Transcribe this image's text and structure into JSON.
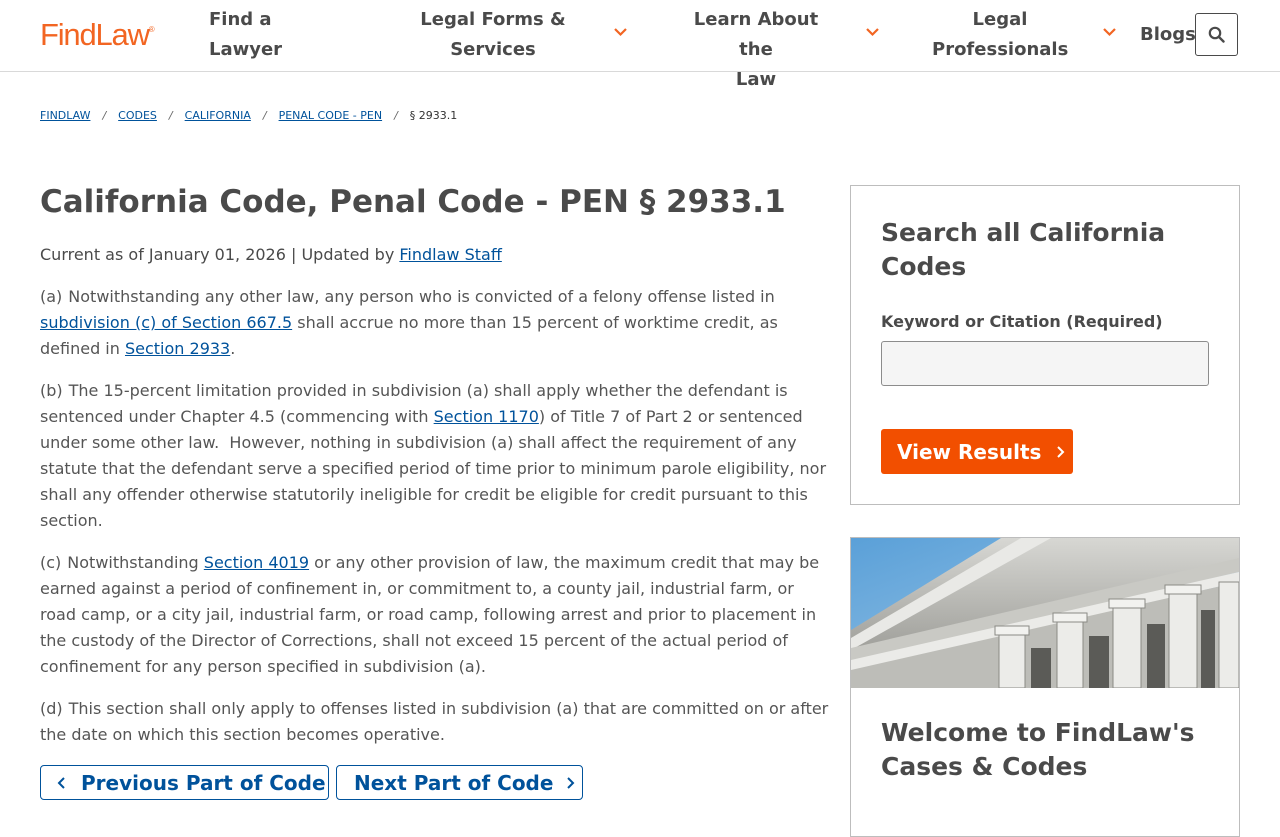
{
  "header": {
    "logo": "FindLaw",
    "logo_mark": "®",
    "nav": [
      {
        "line1": "Find a",
        "line2": "Lawyer"
      },
      {
        "line1": "Legal Forms &",
        "line2": "Services"
      },
      {
        "line1": "Learn About the",
        "line2": "Law"
      },
      {
        "line1": "Legal",
        "line2": "Professionals"
      },
      {
        "line1": "Blogs"
      }
    ],
    "search_icon": "search-icon",
    "accent": "#f26522"
  },
  "breadcrumb": {
    "items": [
      "FINDLAW",
      "CODES",
      "CALIFORNIA",
      "PENAL CODE - PEN"
    ],
    "current": "§ 2933.1",
    "separator": "/"
  },
  "article": {
    "title": "California Code, Penal Code - PEN § 2933.1",
    "meta_prefix": "Current as of January 01, 2026 | Updated by ",
    "meta_link": "Findlaw Staff",
    "paragraphs": {
      "a": {
        "label": "(a)",
        "t1": "Notwithstanding any other law, any person who is convicted of a felony offense listed in ",
        "link1": "subdivision (c) of Section 667.5",
        "t2": " shall accrue no more than 15 percent of worktime credit, as defined in ",
        "link2": "Section 2933",
        "t3": "."
      },
      "b": {
        "label": "(b)",
        "t1": "The 15-percent limitation provided in subdivision (a) shall apply whether the defendant is sentenced under Chapter 4.5 (commencing with ",
        "link1": "Section 1170",
        "t2": ") of Title 7 of Part 2 or sentenced under some other law.  However, nothing in subdivision (a) shall affect the requirement of any statute that the defendant serve a specified period of time prior to minimum parole eligibility, nor shall any offender otherwise statutorily ineligible for credit be eligible for credit pursuant to this section."
      },
      "c": {
        "label": "(c)",
        "t1": "Notwithstanding ",
        "link1": "Section 4019",
        "t2": " or any other provision of law, the maximum credit that may be earned against a period of confinement in, or commitment to, a county jail, industrial farm, or road camp, or a city jail, industrial farm, or road camp, following arrest and prior to placement in the custody of the Director of Corrections, shall not exceed 15 percent of the actual period of confinement for any person specified in subdivision (a)."
      },
      "d": {
        "label": "(d)",
        "t1": "This section shall only apply to offenses listed in subdivision (a) that are committed on or after the date on which this section becomes operative."
      }
    },
    "prev_label": "Previous Part of Code",
    "next_label": "Next Part of Code"
  },
  "sidebar": {
    "search": {
      "heading": "Search all California Codes",
      "field_label": "Keyword or Citation (Required)",
      "field_value": "",
      "button_label": "View Results",
      "button_color": "#f24f00"
    },
    "promo": {
      "heading": "Welcome to FindLaw's Cases & Codes",
      "image_alt": "courthouse-facade-image"
    }
  },
  "colors": {
    "link": "#00529b",
    "text": "#4a4a4a",
    "accent": "#f26522"
  }
}
